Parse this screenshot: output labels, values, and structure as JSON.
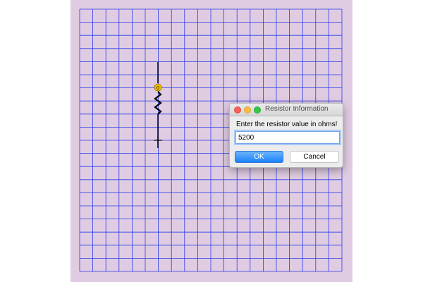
{
  "canvas": {
    "background_color": "#e0cce2",
    "grid_color": "#2a3ae8",
    "grid_columns": 20,
    "grid_rows": 20
  },
  "circuit": {
    "component": "resistor",
    "terminal_label": "0",
    "terminal_color": "#f2c400",
    "wire_color": "#000000"
  },
  "dialog": {
    "title": "Resistor Information",
    "prompt": "Enter the resistor value in ohms!",
    "input_value": "5200",
    "ok_label": "OK",
    "cancel_label": "Cancel"
  }
}
